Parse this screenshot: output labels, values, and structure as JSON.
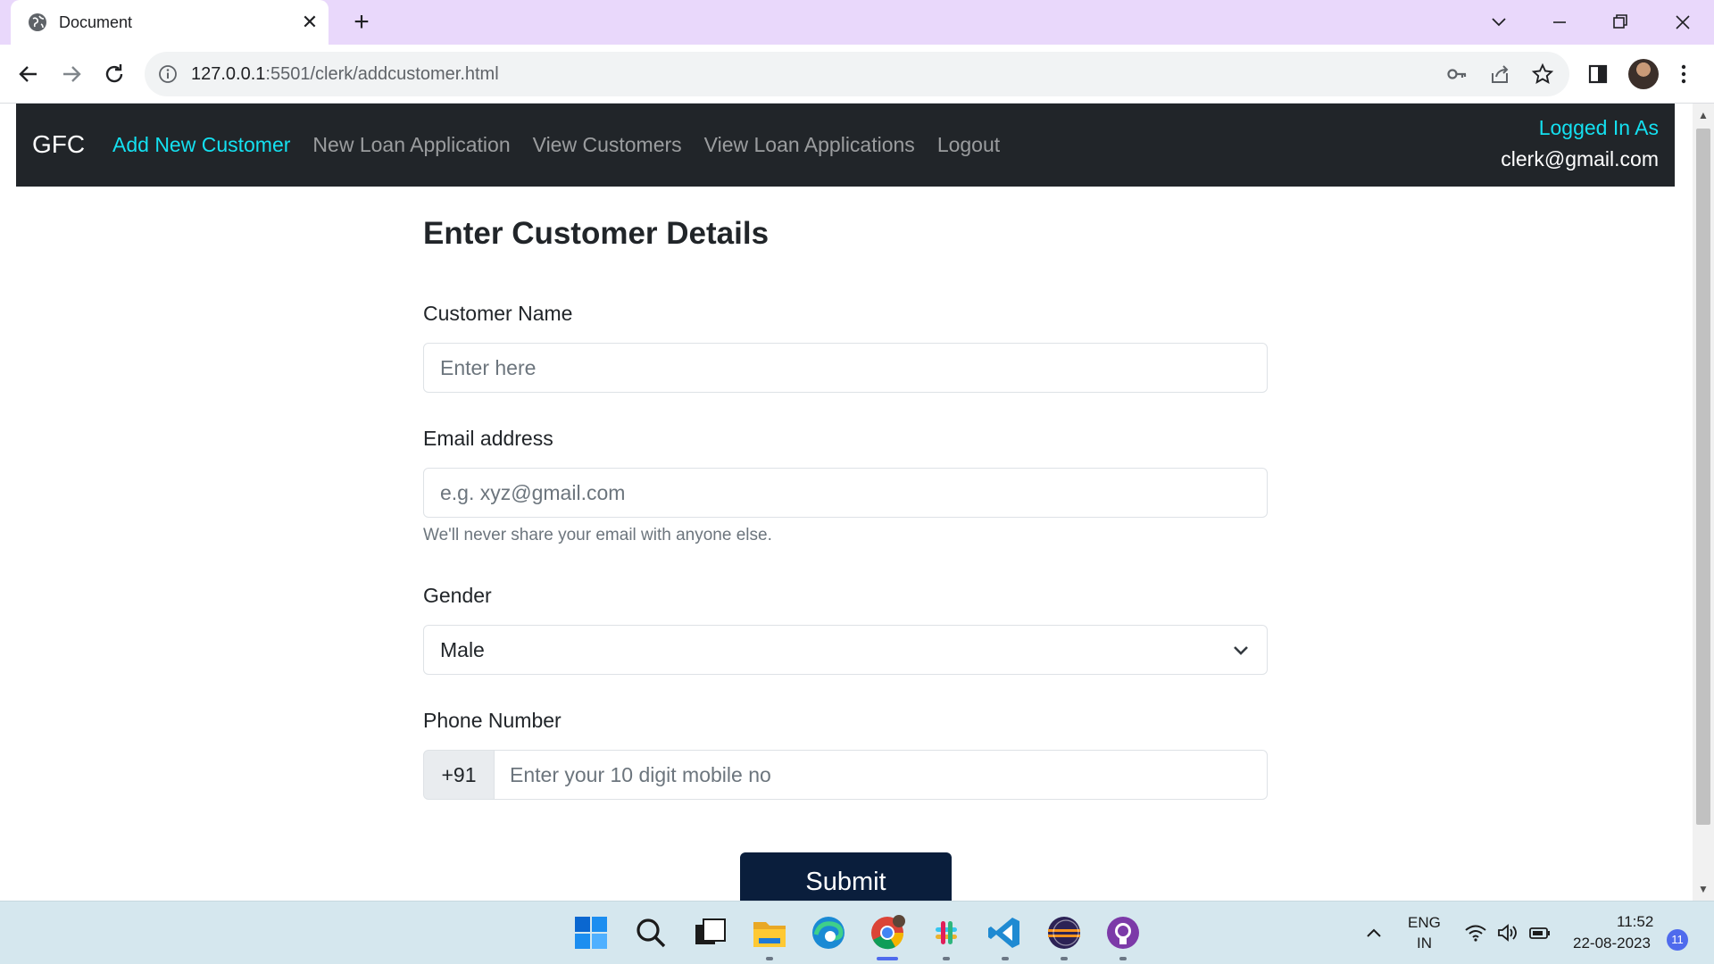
{
  "browser": {
    "tab_title": "Document",
    "url_host": "127.0.0.1",
    "url_rest": ":5501/clerk/addcustomer.html"
  },
  "navbar": {
    "brand": "GFC",
    "links": [
      {
        "label": "Add New Customer",
        "active": true
      },
      {
        "label": "New Loan Application",
        "active": false
      },
      {
        "label": "View Customers",
        "active": false
      },
      {
        "label": "View Loan Applications",
        "active": false
      },
      {
        "label": "Logout",
        "active": false
      }
    ],
    "logged_in_label": "Logged In As",
    "logged_in_email": "clerk@gmail.com"
  },
  "form": {
    "title": "Enter Customer Details",
    "name_label": "Customer Name",
    "name_placeholder": "Enter here",
    "email_label": "Email address",
    "email_placeholder": "e.g. xyz@gmail.com",
    "email_help": "We'll never share your email with anyone else.",
    "gender_label": "Gender",
    "gender_value": "Male",
    "phone_label": "Phone Number",
    "phone_prefix": "+91",
    "phone_placeholder": "Enter your 10 digit mobile no",
    "submit_label": "Submit"
  },
  "taskbar": {
    "language": "ENG",
    "region": "IN",
    "time": "11:52",
    "date": "22-08-2023",
    "notification_count": "11",
    "apps": [
      "start-icon",
      "search-icon",
      "task-view-icon",
      "file-explorer-icon",
      "edge-icon",
      "chrome-icon",
      "slack-icon",
      "vscode-icon",
      "eclipse-icon",
      "github-desktop-icon"
    ]
  },
  "colors": {
    "navbar_bg": "#212529",
    "nav_active": "#14e0f0",
    "submit_bg": "#0a1e3c",
    "tabstrip_bg": "#e9d8fb",
    "taskbar_bg": "#d5e7ee"
  }
}
